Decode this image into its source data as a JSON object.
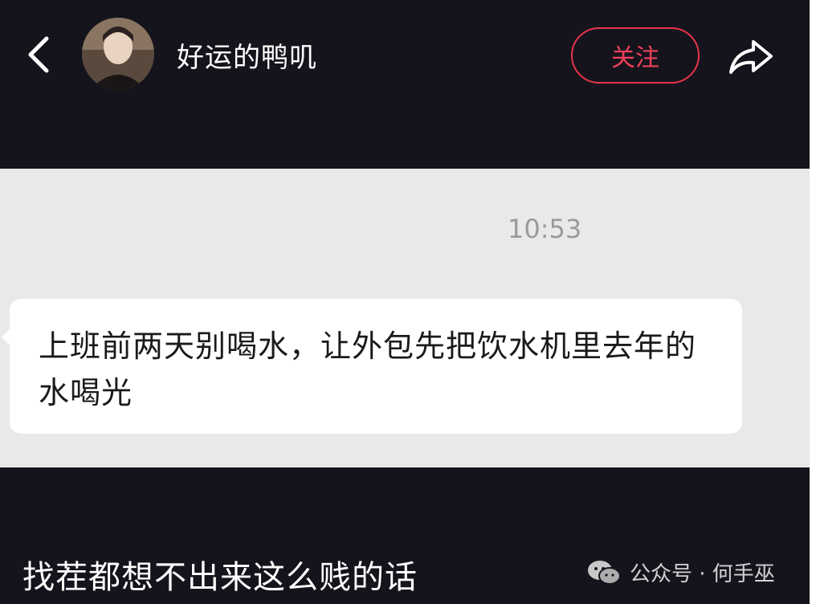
{
  "header": {
    "username": "好运的鸭叽",
    "follow_label": "关注",
    "icons": {
      "back": "chevron-left-icon",
      "share": "share-arrow-icon",
      "avatar": "user-avatar"
    }
  },
  "chat": {
    "timestamp": "10:53",
    "message": "上班前两天别喝水，让外包先把饮水机里去年的水喝光"
  },
  "caption": "找茬都想不出来这么贱的话",
  "watermark": {
    "text": "公众号 · 何手巫",
    "icon": "wechat-icon"
  },
  "colors": {
    "background": "#15141d",
    "chat_background": "#e9e9e9",
    "bubble": "#ffffff",
    "accent": "#e8344a",
    "timestamp": "#9a9a9a"
  }
}
